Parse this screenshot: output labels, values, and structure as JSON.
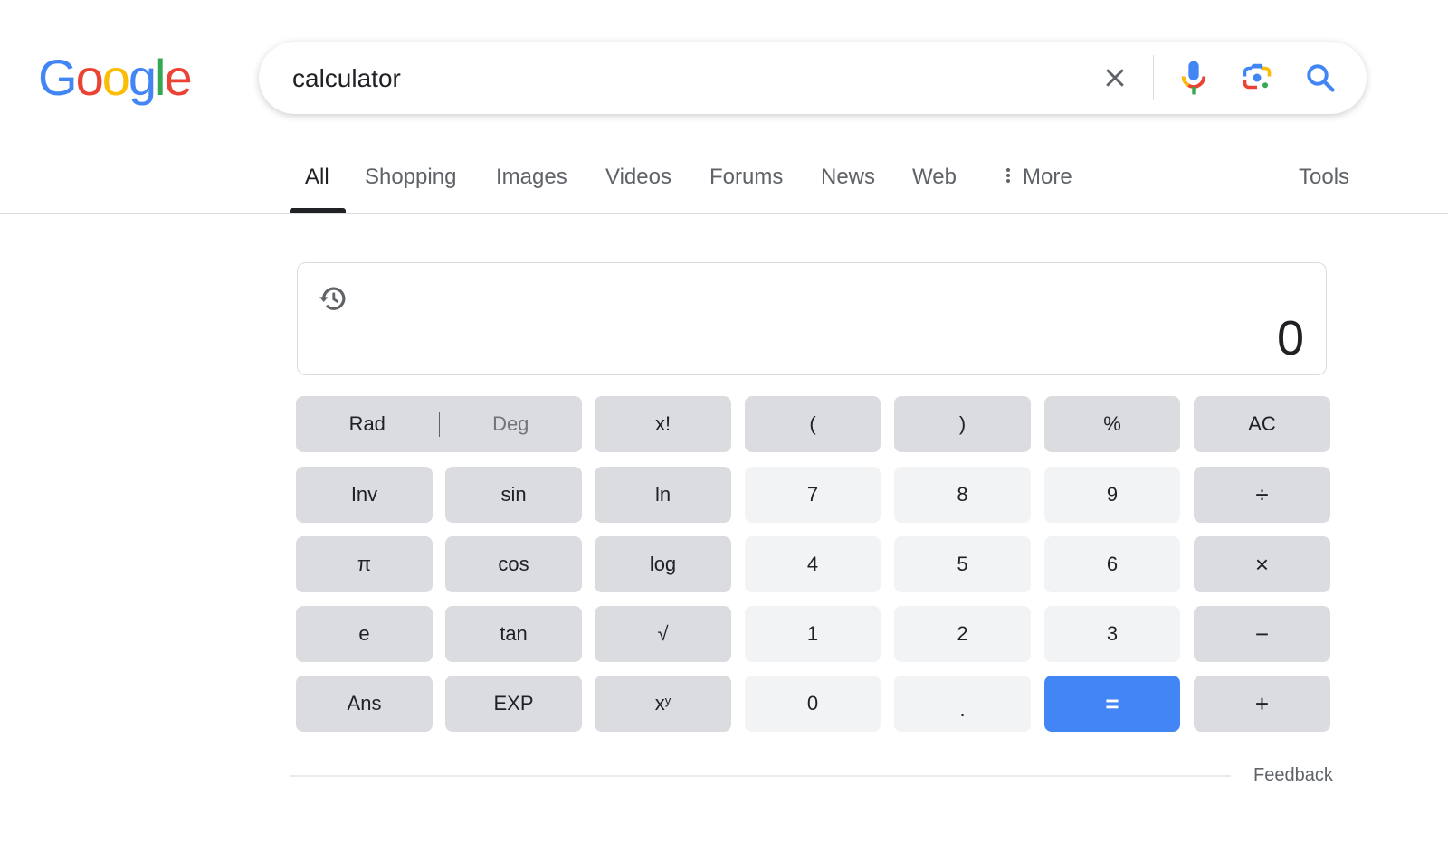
{
  "logo": {
    "letters": [
      {
        "ch": "G",
        "color": "#4285f4"
      },
      {
        "ch": "o",
        "color": "#ea4335"
      },
      {
        "ch": "o",
        "color": "#fbbc05"
      },
      {
        "ch": "g",
        "color": "#4285f4"
      },
      {
        "ch": "l",
        "color": "#34a853"
      },
      {
        "ch": "e",
        "color": "#ea4335"
      }
    ]
  },
  "search": {
    "value": "calculator",
    "icons": [
      "close-icon",
      "microphone-icon",
      "google-lens-icon",
      "search-icon"
    ]
  },
  "tabs": [
    {
      "label": "All",
      "active": true
    },
    {
      "label": "Shopping"
    },
    {
      "label": "Images"
    },
    {
      "label": "Videos"
    },
    {
      "label": "Forums"
    },
    {
      "label": "News"
    },
    {
      "label": "Web"
    },
    {
      "label": "More",
      "icon": "more-vert-icon"
    }
  ],
  "tools_label": "Tools",
  "calculator": {
    "display_value": "0",
    "history_icon": "history-icon",
    "rad_label": "Rad",
    "deg_label": "Deg",
    "keys": [
      [
        "x!",
        "(",
        ")",
        "%",
        "AC"
      ],
      [
        "Inv",
        "sin",
        "ln",
        "7",
        "8",
        "9",
        "÷"
      ],
      [
        "π",
        "cos",
        "log",
        "4",
        "5",
        "6",
        "×"
      ],
      [
        "e",
        "tan",
        "√",
        "1",
        "2",
        "3",
        "−"
      ],
      [
        "Ans",
        "EXP",
        "x",
        "0",
        ".",
        "=",
        "+"
      ]
    ],
    "pow_sup": "y"
  },
  "colors": {
    "accent": "#4285f4",
    "function_key": "#dadce0",
    "number_key": "#f1f3f4"
  },
  "feedback_label": "Feedback"
}
